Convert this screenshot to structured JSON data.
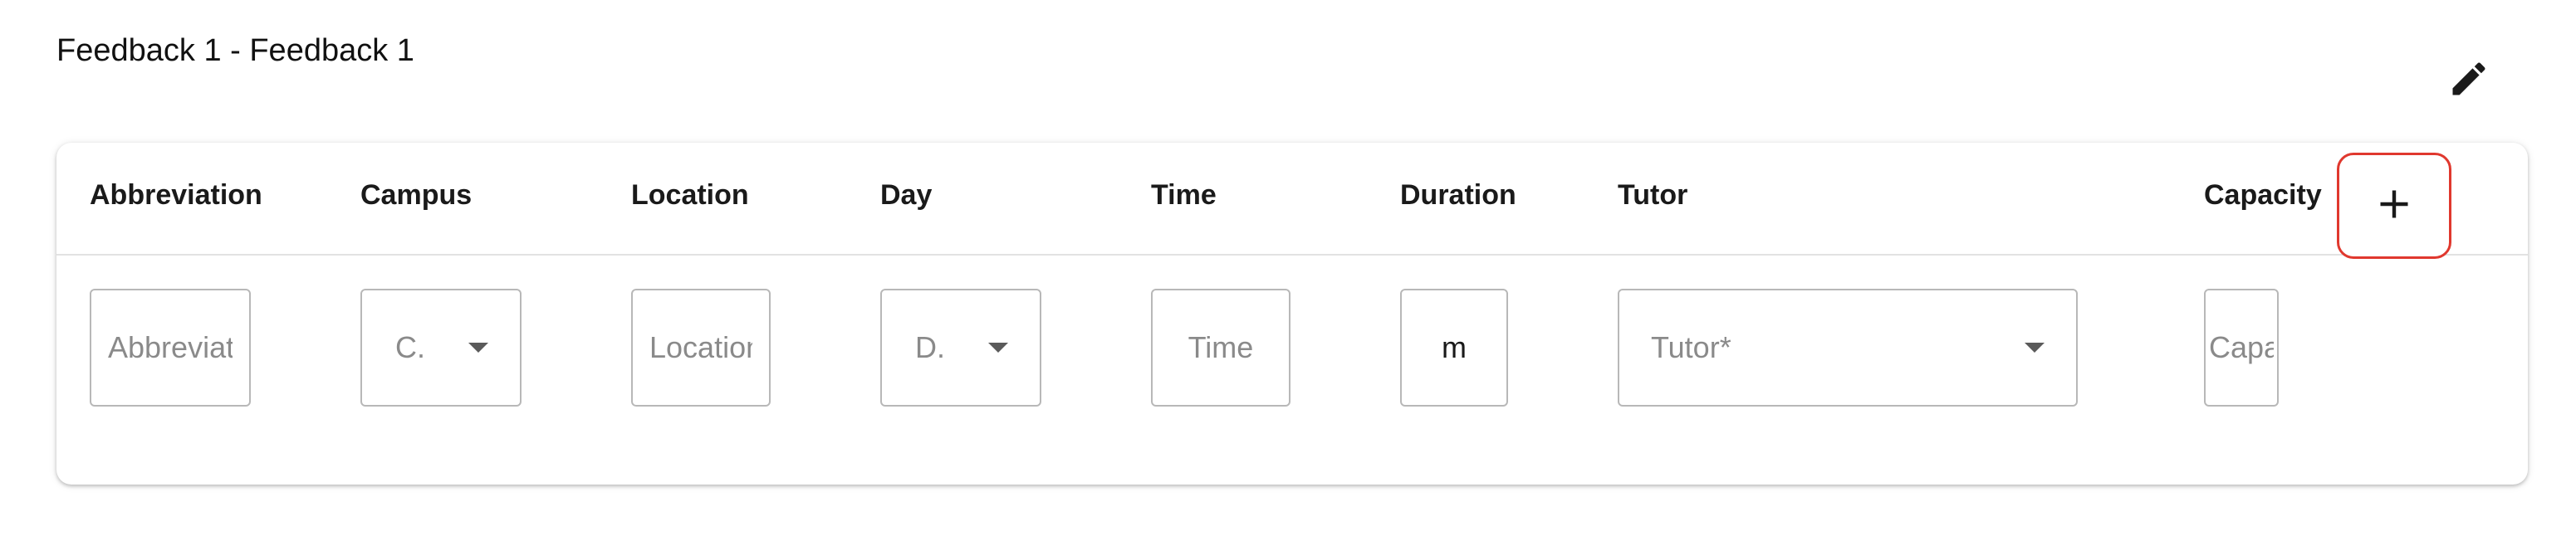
{
  "section": {
    "title": "Feedback 1 - Feedback 1",
    "edit_icon": "pencil-icon"
  },
  "table": {
    "headers": {
      "abbreviation": "Abbreviation",
      "campus": "Campus",
      "location": "Location",
      "day": "Day",
      "time": "Time",
      "duration": "Duration",
      "tutor": "Tutor",
      "capacity": "Capacity"
    },
    "inputs": {
      "abbreviation_placeholder": "Abbreviation",
      "campus_value": "C.",
      "location_placeholder": "Location",
      "day_value": "D.",
      "time_placeholder": "Time",
      "duration_value": "m",
      "tutor_placeholder": "Tutor*",
      "capacity_placeholder": "Capacity"
    },
    "add_icon": "plus-icon",
    "colors": {
      "add_button_border": "#e0382e",
      "field_border": "#b8b8b8"
    }
  }
}
